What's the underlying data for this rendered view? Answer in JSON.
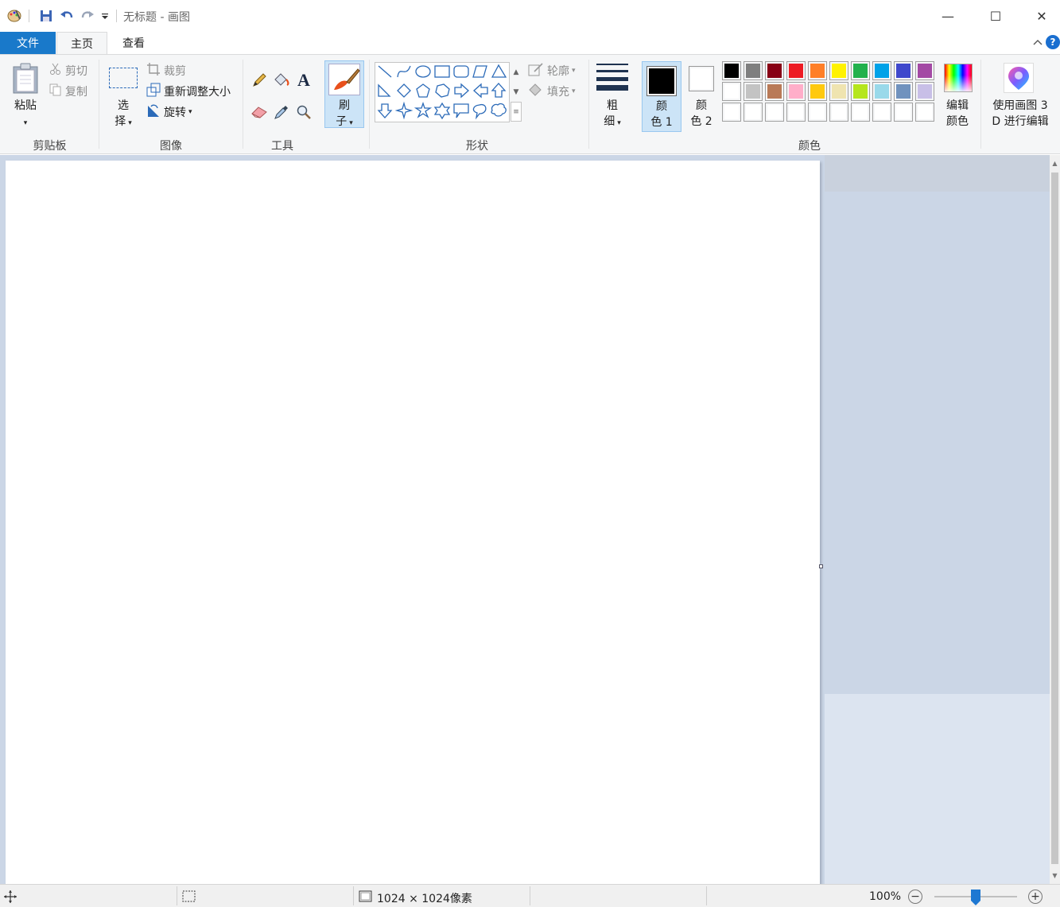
{
  "window": {
    "title": "无标题 - 画图",
    "controls": {
      "minimize": "—",
      "maximize": "☐",
      "close": "✕"
    }
  },
  "tabs": [
    {
      "label": "文件"
    },
    {
      "label": "主页"
    },
    {
      "label": "查看"
    }
  ],
  "ribbon": {
    "clipboard": {
      "group_label": "剪贴板",
      "paste_label": "粘贴",
      "cut_label": "剪切",
      "copy_label": "复制"
    },
    "image": {
      "group_label": "图像",
      "select_label_line1": "选",
      "select_label_line2": "择",
      "crop_label": "裁剪",
      "resize_label": "重新调整大小",
      "rotate_label": "旋转"
    },
    "tools": {
      "group_label": "工具",
      "brush_label_line1": "刷",
      "brush_label_line2": "子"
    },
    "shapes": {
      "group_label": "形状",
      "outline_label": "轮廓",
      "fill_label": "填充"
    },
    "size": {
      "label_line1": "粗",
      "label_line2": "细"
    },
    "colors": {
      "group_label": "颜色",
      "color1_line1": "颜",
      "color1_line2": "色 1",
      "color2_line1": "颜",
      "color2_line2": "色 2",
      "edit_colors_line1": "编辑",
      "edit_colors_line2": "颜色",
      "paint3d_line1": "使用画图 3",
      "paint3d_line2": "D 进行编辑",
      "color1_value": "#000000",
      "color2_value": "#ffffff",
      "palette_row1": [
        "#000000",
        "#7f7f7f",
        "#880015",
        "#ed1c24",
        "#ff7f27",
        "#fff200",
        "#22b14c",
        "#00a2e8",
        "#3f48cc",
        "#a349a4"
      ],
      "palette_row2": [
        "#ffffff",
        "#c3c3c3",
        "#b97a57",
        "#ffaec9",
        "#ffc90e",
        "#efe4b0",
        "#b5e61d",
        "#99d9ea",
        "#7092be",
        "#c8bfe7"
      ],
      "palette_row3": [
        "#ffffff",
        "#ffffff",
        "#ffffff",
        "#ffffff",
        "#ffffff",
        "#ffffff",
        "#ffffff",
        "#ffffff",
        "#ffffff",
        "#ffffff"
      ]
    }
  },
  "statusbar": {
    "image_size": "1024 × 1024像素",
    "zoom": "100%",
    "zoom_out": "−",
    "zoom_in": "+"
  }
}
